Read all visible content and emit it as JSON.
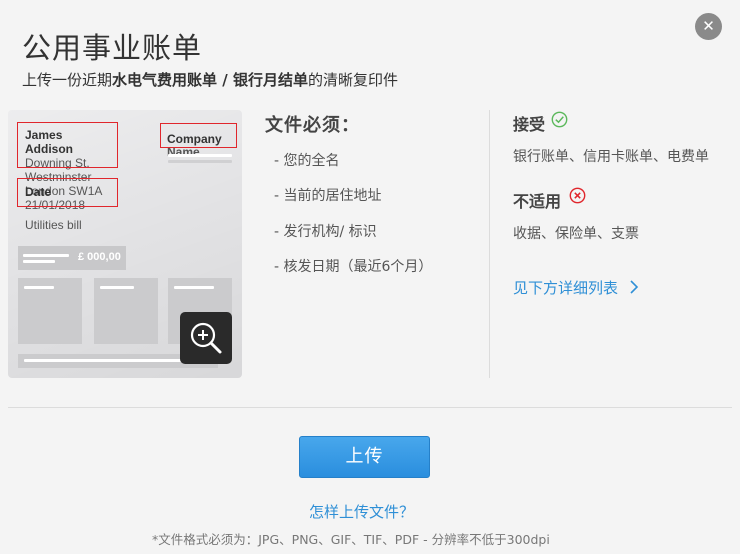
{
  "dialog": {
    "title": "公用事业账单",
    "subtitle_prefix": "上传一份近期",
    "subtitle_bold": "水电气费用账单 / 银行月结单",
    "subtitle_suffix": "的清晰复印件",
    "close_symbol": "✕"
  },
  "sample_document": {
    "name_line1": "James",
    "name_line2": "Addison",
    "address_line1": "Downing St.",
    "address_line2": "Westminster",
    "address_line3": "London SW1A",
    "date_label": "Date",
    "date_value": "21/01/2018",
    "company_line1": "Company",
    "company_line2": "Name",
    "doc_type": "Utilities bill",
    "amount": "£ 000,00"
  },
  "requirements": {
    "title": "文件必须：",
    "items": [
      "您的全名",
      "当前的居住地址",
      "发行机构/ 标识",
      "核发日期（最近6个月）"
    ]
  },
  "accepted": {
    "title": "接受",
    "text": "银行账单、信用卡账单、电费单"
  },
  "not_applicable": {
    "title": "不适用",
    "text": "收据、保险单、支票"
  },
  "detail_link": "见下方详细列表",
  "upload_button": "上传",
  "howto_link": "怎样上传文件？",
  "formats_note": "*文件格式必须为：JPG、PNG、GIF、TIF、PDF - 分辨率不低于300dpi",
  "colors": {
    "accent_blue": "#2e8fd6",
    "accept_green": "#5bb85b",
    "reject_red": "#e0262c",
    "highlight_box": "#e0262c"
  }
}
